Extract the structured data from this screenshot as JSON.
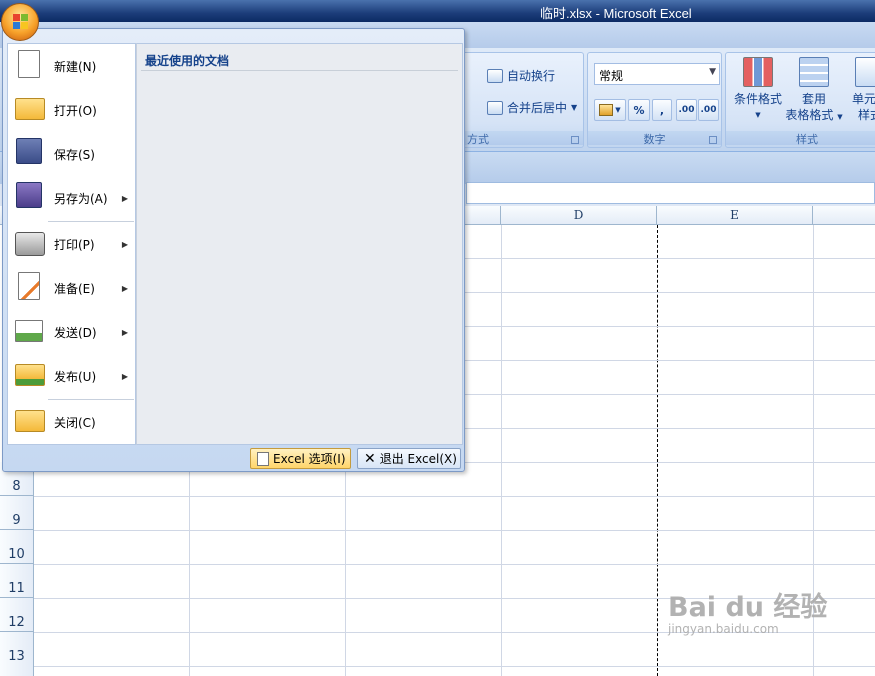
{
  "window": {
    "title": "临时.xlsx - Microsoft Excel"
  },
  "ribbon": {
    "alignment": {
      "wrap_text": "自动换行",
      "merge_center": "合并后居中",
      "group_label": "方式"
    },
    "number": {
      "format": "常规",
      "percent": "%",
      "comma": ",",
      "inc_decimal": ".00",
      "dec_decimal": ".00",
      "group_label": "数字"
    },
    "styles": {
      "conditional_format": "条件格式",
      "table_format_line1": "套用",
      "table_format_line2": "表格格式",
      "cell_styles_line1": "单元格",
      "cell_styles_line2": "样式",
      "group_label": "样式"
    }
  },
  "sheet": {
    "columns": [
      "D",
      "E"
    ],
    "rows": [
      "8",
      "9",
      "10",
      "11",
      "12",
      "13"
    ]
  },
  "office_menu": {
    "items": [
      {
        "label": "新建(N)",
        "icon": "new-document-icon",
        "submenu": false
      },
      {
        "label": "打开(O)",
        "icon": "open-folder-icon",
        "submenu": false
      },
      {
        "label": "保存(S)",
        "icon": "save-disk-icon",
        "submenu": false
      },
      {
        "label": "另存为(A)",
        "icon": "save-as-icon",
        "submenu": true
      },
      {
        "label": "打印(P)",
        "icon": "printer-icon",
        "submenu": true
      },
      {
        "label": "准备(E)",
        "icon": "prepare-icon",
        "submenu": true
      },
      {
        "label": "发送(D)",
        "icon": "send-icon",
        "submenu": true
      },
      {
        "label": "发布(U)",
        "icon": "publish-icon",
        "submenu": true
      },
      {
        "label": "关闭(C)",
        "icon": "close-folder-icon",
        "submenu": false
      }
    ],
    "recent_title": "最近使用的文档",
    "options_button": "Excel 选项(I)",
    "exit_button": "退出 Excel(X)"
  },
  "watermark": {
    "main": "Bai du 经验",
    "sub": "jingyan.baidu.com"
  }
}
